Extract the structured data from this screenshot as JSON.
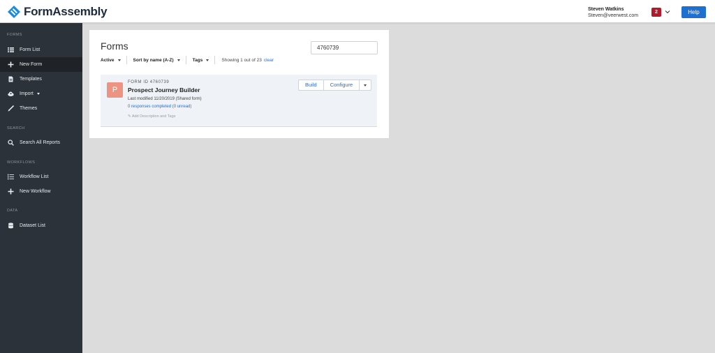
{
  "app": {
    "logo_text": "FormAssembly"
  },
  "header": {
    "user_name": "Steven Watkins",
    "user_email": "Steven@veerwest.com",
    "notification_count": "2",
    "help_label": "Help"
  },
  "sidebar": {
    "sections": [
      {
        "label": "FORMS"
      },
      {
        "label": "SEARCH"
      },
      {
        "label": "WORKFLOWS"
      },
      {
        "label": "DATA"
      }
    ],
    "items": [
      {
        "label": "Form List",
        "icon": "list-icon"
      },
      {
        "label": "New Form",
        "icon": "plus-icon",
        "active": true
      },
      {
        "label": "Templates",
        "icon": "document-icon"
      },
      {
        "label": "Import",
        "icon": "cloud-upload-icon"
      },
      {
        "label": "Themes",
        "icon": "brush-icon"
      },
      {
        "label": "Search All Reports",
        "icon": "search-icon"
      },
      {
        "label": "Workflow List",
        "icon": "numbered-list-icon"
      },
      {
        "label": "New Workflow",
        "icon": "plus-icon"
      },
      {
        "label": "Dataset List",
        "icon": "database-icon"
      }
    ]
  },
  "main": {
    "title": "Forms",
    "search_value": "4760739",
    "filters": {
      "status": "Active",
      "sort": "Sort by name (A-Z)",
      "tags": "Tags",
      "showing": "Showing 1 out of 23",
      "clear": "clear"
    },
    "form": {
      "avatar_letter": "P",
      "form_id": "FORM ID 4760739",
      "name": "Prospect Journey Builder",
      "modified": "Last modified 11/20/2019 (Shared form)",
      "responses": "0 responses completed (0 unread)",
      "add_description": "✎ Add Description and Tags",
      "build_label": "Build",
      "configure_label": "Configure"
    }
  },
  "colors": {
    "sidebar_bg": "#2b323a",
    "accent": "#1f6fd1",
    "notification": "#b3192a",
    "avatar": "#ec9481"
  }
}
